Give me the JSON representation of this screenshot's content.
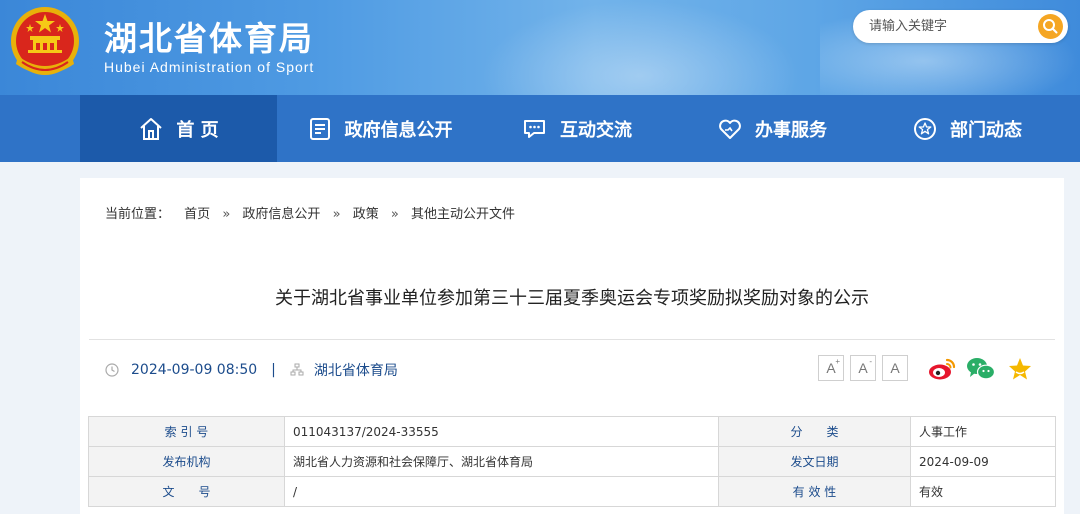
{
  "header": {
    "site_title": "湖北省体育局",
    "site_subtitle": "Hubei Administration of Sport",
    "search_placeholder": "请输入关键字"
  },
  "nav": {
    "items": [
      {
        "label": "首 页",
        "icon": "home-icon"
      },
      {
        "label": "政府信息公开",
        "icon": "document-list-icon"
      },
      {
        "label": "互动交流",
        "icon": "chat-icon"
      },
      {
        "label": "办事服务",
        "icon": "heart-hands-icon"
      },
      {
        "label": "部门动态",
        "icon": "star-circle-icon"
      }
    ]
  },
  "breadcrumb": {
    "prefix": "当前位置：",
    "items": [
      "首页",
      "政府信息公开",
      "政策",
      "其他主动公开文件"
    ],
    "separator": "»"
  },
  "article": {
    "title": "关于湖北省事业单位参加第三十三届夏季奥运会专项奖励拟奖励对象的公示",
    "date": "2024-09-09 08:50",
    "divider": "|",
    "source": "湖北省体育局"
  },
  "font_controls": {
    "increase": "A",
    "decrease": "A",
    "reset": "A",
    "increase_mark": "+",
    "decrease_mark": "-"
  },
  "share": [
    "weibo-icon",
    "wechat-icon",
    "favorite-star-icon"
  ],
  "info_table": {
    "rows": [
      {
        "label1": "索 引 号",
        "value1": "011043137/2024-33555",
        "label2": "分　　类",
        "value2": "人事工作"
      },
      {
        "label1": "发布机构",
        "value1": "湖北省人力资源和社会保障厅、湖北省体育局",
        "label2": "发文日期",
        "value2": "2024-09-09"
      },
      {
        "label1": "文　　号",
        "value1": "/",
        "label2": "有 效 性",
        "value2": "有效"
      }
    ]
  },
  "colors": {
    "header_blue": "#3b87d8",
    "nav_blue": "#2f73c7",
    "nav_active": "#1c5aaa",
    "label_blue": "#1c4c8c",
    "search_orange": "#f5a623",
    "weibo_red": "#e6162d",
    "wechat_green": "#2aae67",
    "star_yellow": "#f5b800"
  }
}
